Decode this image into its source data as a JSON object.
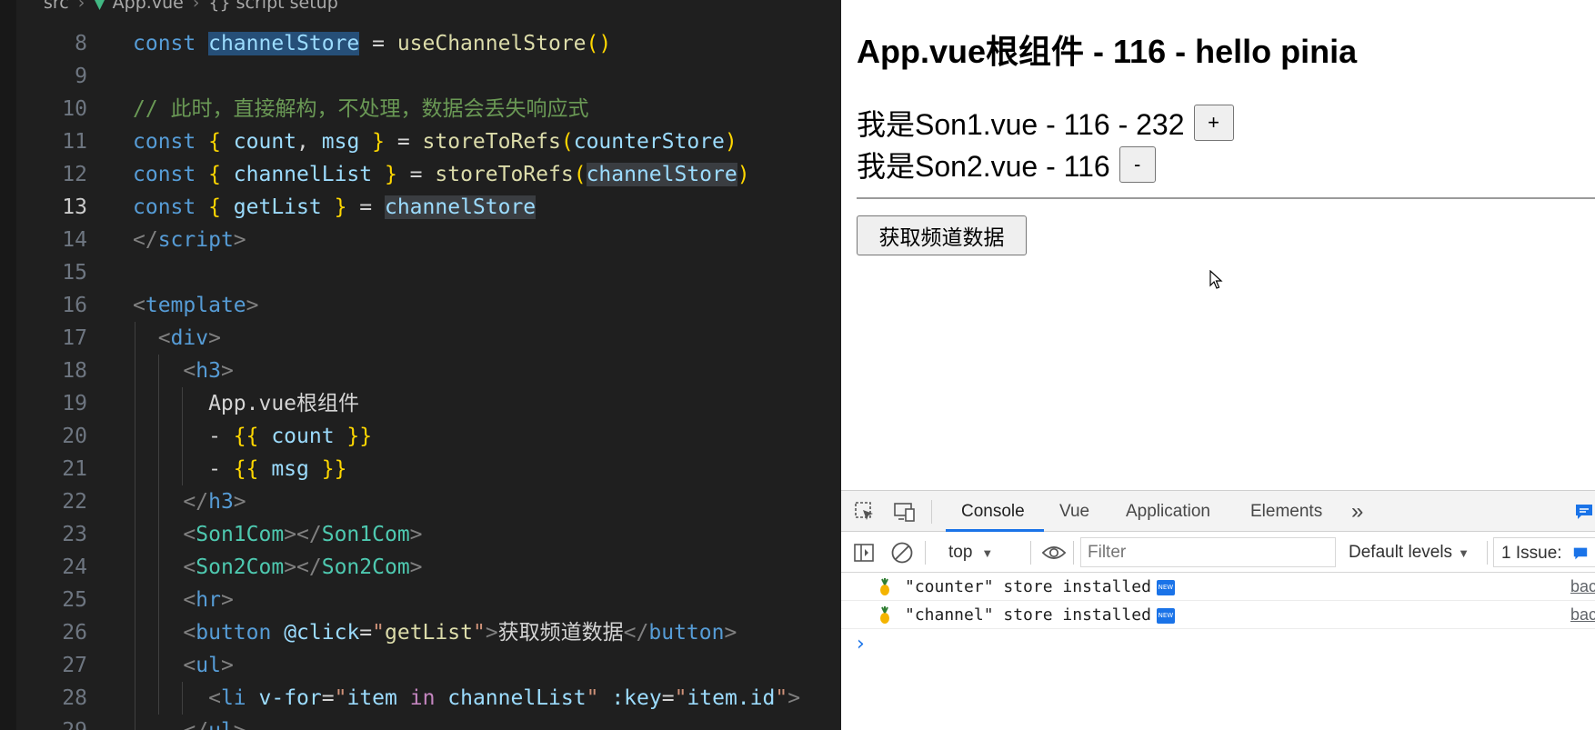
{
  "editor": {
    "breadcrumb": {
      "folder": "src",
      "file": "App.vue",
      "section": "{} script setup"
    },
    "lines": [
      {
        "n": "8",
        "tokens": [
          [
            "k",
            "const "
          ],
          [
            "v hl",
            "channelStore"
          ],
          [
            "p",
            " = "
          ],
          [
            "f",
            "useChannelStore"
          ],
          [
            "b",
            "()"
          ]
        ]
      },
      {
        "n": "9",
        "tokens": []
      },
      {
        "n": "10",
        "tokens": [
          [
            "c",
            "// 此时，直接解构，不处理，数据会丢失响应式"
          ]
        ]
      },
      {
        "n": "11",
        "tokens": [
          [
            "k",
            "const "
          ],
          [
            "b",
            "{ "
          ],
          [
            "v",
            "count"
          ],
          [
            "p",
            ", "
          ],
          [
            "v",
            "msg"
          ],
          [
            "b",
            " }"
          ],
          [
            "p",
            " = "
          ],
          [
            "f",
            "storeToRefs"
          ],
          [
            "b",
            "("
          ],
          [
            "v",
            "counterStore"
          ],
          [
            "b",
            ")"
          ]
        ]
      },
      {
        "n": "12",
        "tokens": [
          [
            "k",
            "const "
          ],
          [
            "b",
            "{ "
          ],
          [
            "v",
            "channelList"
          ],
          [
            "b",
            " }"
          ],
          [
            "p",
            " = "
          ],
          [
            "f",
            "storeToRefs"
          ],
          [
            "b",
            "("
          ],
          [
            "v hl2",
            "channelStore"
          ],
          [
            "b",
            ")"
          ]
        ]
      },
      {
        "n": "13",
        "tokens": [
          [
            "k",
            "const "
          ],
          [
            "b",
            "{ "
          ],
          [
            "v",
            "getList"
          ],
          [
            "b",
            " }"
          ],
          [
            "p",
            " = "
          ],
          [
            "v hl2",
            "channelStore"
          ]
        ],
        "active": true
      },
      {
        "n": "14",
        "tokens": [
          [
            "tgb",
            "</"
          ],
          [
            "tg",
            "script"
          ],
          [
            "tgb",
            ">"
          ]
        ]
      },
      {
        "n": "15",
        "tokens": []
      },
      {
        "n": "16",
        "tokens": [
          [
            "tgb",
            "<"
          ],
          [
            "tg",
            "template"
          ],
          [
            "tgb",
            ">"
          ]
        ]
      },
      {
        "n": "17",
        "tokens": [
          [
            "p",
            "  "
          ],
          [
            "tgb",
            "<"
          ],
          [
            "tg",
            "div"
          ],
          [
            "tgb",
            ">"
          ]
        ]
      },
      {
        "n": "18",
        "tokens": [
          [
            "p",
            "    "
          ],
          [
            "tgb",
            "<"
          ],
          [
            "tg",
            "h3"
          ],
          [
            "tgb",
            ">"
          ]
        ]
      },
      {
        "n": "19",
        "tokens": [
          [
            "p",
            "      App.vue根组件"
          ]
        ]
      },
      {
        "n": "20",
        "tokens": [
          [
            "p",
            "      - "
          ],
          [
            "b",
            "{{ "
          ],
          [
            "v",
            "count"
          ],
          [
            "b",
            " }}"
          ]
        ]
      },
      {
        "n": "21",
        "tokens": [
          [
            "p",
            "      - "
          ],
          [
            "b",
            "{{ "
          ],
          [
            "v",
            "msg"
          ],
          [
            "b",
            " }}"
          ]
        ]
      },
      {
        "n": "22",
        "tokens": [
          [
            "p",
            "    "
          ],
          [
            "tgb",
            "</"
          ],
          [
            "tg",
            "h3"
          ],
          [
            "tgb",
            ">"
          ]
        ]
      },
      {
        "n": "23",
        "tokens": [
          [
            "p",
            "    "
          ],
          [
            "tgb",
            "<"
          ],
          [
            "cmp",
            "Son1Com"
          ],
          [
            "tgb",
            "></"
          ],
          [
            "cmp",
            "Son1Com"
          ],
          [
            "tgb",
            ">"
          ]
        ]
      },
      {
        "n": "24",
        "tokens": [
          [
            "p",
            "    "
          ],
          [
            "tgb",
            "<"
          ],
          [
            "cmp",
            "Son2Com"
          ],
          [
            "tgb",
            "></"
          ],
          [
            "cmp",
            "Son2Com"
          ],
          [
            "tgb",
            ">"
          ]
        ]
      },
      {
        "n": "25",
        "tokens": [
          [
            "p",
            "    "
          ],
          [
            "tgb",
            "<"
          ],
          [
            "tg",
            "hr"
          ],
          [
            "tgb",
            ">"
          ]
        ]
      },
      {
        "n": "26",
        "tokens": [
          [
            "p",
            "    "
          ],
          [
            "tgb",
            "<"
          ],
          [
            "tg",
            "button"
          ],
          [
            "p",
            " "
          ],
          [
            "at",
            "@click"
          ],
          [
            "p",
            "="
          ],
          [
            "s",
            "\""
          ],
          [
            "f",
            "getList"
          ],
          [
            "s",
            "\""
          ],
          [
            "tgb",
            ">"
          ],
          [
            "p",
            "获取频道数据"
          ],
          [
            "tgb",
            "</"
          ],
          [
            "tg",
            "button"
          ],
          [
            "tgb",
            ">"
          ]
        ]
      },
      {
        "n": "27",
        "tokens": [
          [
            "p",
            "    "
          ],
          [
            "tgb",
            "<"
          ],
          [
            "tg",
            "ul"
          ],
          [
            "tgb",
            ">"
          ]
        ]
      },
      {
        "n": "28",
        "tokens": [
          [
            "p",
            "      "
          ],
          [
            "tgb",
            "<"
          ],
          [
            "tg",
            "li"
          ],
          [
            "p",
            " "
          ],
          [
            "at",
            "v-for"
          ],
          [
            "p",
            "="
          ],
          [
            "s",
            "\""
          ],
          [
            "v",
            "item"
          ],
          [
            "ctl",
            " in "
          ],
          [
            "v",
            "channelList"
          ],
          [
            "s",
            "\""
          ],
          [
            "p",
            " "
          ],
          [
            "at",
            ":key"
          ],
          [
            "p",
            "="
          ],
          [
            "s",
            "\""
          ],
          [
            "v",
            "item.id"
          ],
          [
            "s",
            "\""
          ],
          [
            "tgb",
            ">"
          ]
        ]
      },
      {
        "n": "29",
        "tokens": [
          [
            "p",
            "    "
          ],
          [
            "tgb",
            "</"
          ],
          [
            "tg",
            "ul"
          ],
          [
            "tgb",
            ">"
          ]
        ]
      }
    ]
  },
  "browser": {
    "title": "App.vue根组件 - 116 - hello pinia",
    "son1_text": "我是Son1.vue - 116 - 232",
    "son1_button": "+",
    "son2_text": "我是Son2.vue - 116",
    "son2_button": "-",
    "get_list_button": "获取频道数据"
  },
  "devtools": {
    "tabs": [
      "Console",
      "Vue",
      "Application",
      "Elements"
    ],
    "active_tab": "Console",
    "more_tabs": "»",
    "context": "top",
    "filter_placeholder": "Filter",
    "levels": "Default levels",
    "issues": "1 Issue:",
    "logs": [
      {
        "text": "\"counter\" store installed",
        "badge": "NEW",
        "source": "bac"
      },
      {
        "text": "\"channel\" store installed",
        "badge": "NEW",
        "source": "bac"
      }
    ],
    "prompt": "›"
  }
}
